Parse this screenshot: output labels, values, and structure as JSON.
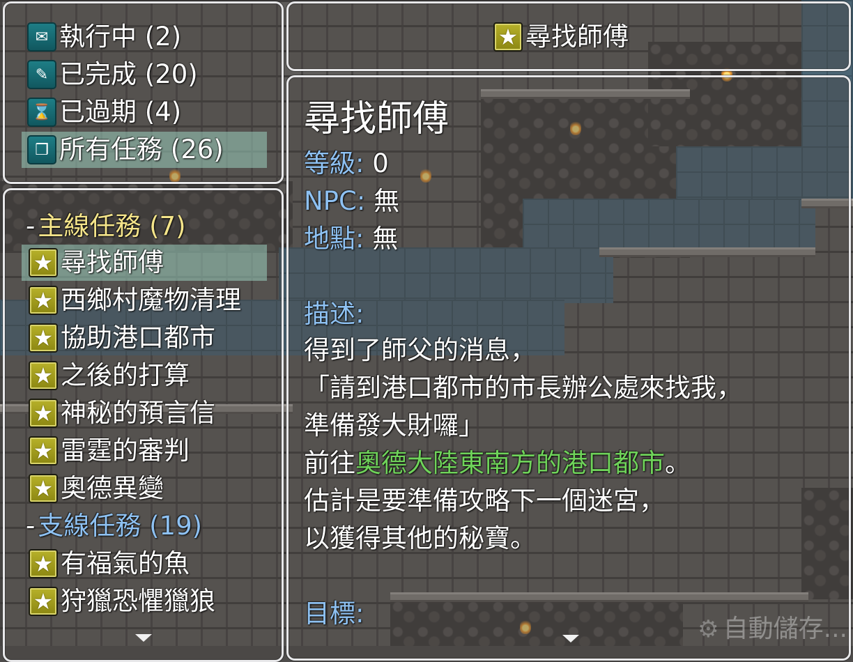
{
  "categories": [
    {
      "icon": "envelope-icon",
      "label": "執行中 (2)"
    },
    {
      "icon": "quill-icon",
      "label": "已完成 (20)"
    },
    {
      "icon": "scroll-icon",
      "label": "已過期 (4)"
    },
    {
      "icon": "open-book-icon",
      "label": "所有任務 (26)",
      "selected": true
    }
  ],
  "quest_list": {
    "main_group": {
      "prefix": "-",
      "label": "主線任務 (7)"
    },
    "main_quests": [
      "尋找師傅",
      "西鄉村魔物清理",
      "協助港口都市",
      "之後的打算",
      "神秘的預言信",
      "雷霆的審判",
      "奧德異變"
    ],
    "side_group": {
      "prefix": "-",
      "label": "支線任務 (19)"
    },
    "side_quests": [
      "有福氣的魚",
      "狩獵恐懼獵狼"
    ],
    "selected_index": 0
  },
  "title_window": {
    "icon": "star-icon",
    "title": "尋找師傅"
  },
  "detail": {
    "quest_name": "尋找師傅",
    "level_label": "等級:",
    "level_value": "0",
    "npc_label": "NPC:",
    "npc_value": "無",
    "location_label": "地點:",
    "location_value": "無",
    "description_label": "描述:",
    "description_lines": [
      "得到了師父的消息，",
      "「請到港口都市的市長辦公處來找我，",
      "準備發大財囉」"
    ],
    "goto_prefix": "前往",
    "goto_highlight": "奧德大陸東南方的港口都市",
    "goto_suffix": "。",
    "description_lines_after": [
      "估計是要準備攻略下一個迷宮，",
      "以獲得其他的秘寶。"
    ],
    "objective_label": "目標:"
  },
  "autosave": {
    "icon": "gear-icon",
    "text": "自動儲存..."
  },
  "colors": {
    "group_main": "#f4e48a",
    "group_side": "#8ec1f2",
    "label_blue": "#8ec1f2",
    "highlight_green": "#6fd35a",
    "selection": "#9bcdbe"
  }
}
